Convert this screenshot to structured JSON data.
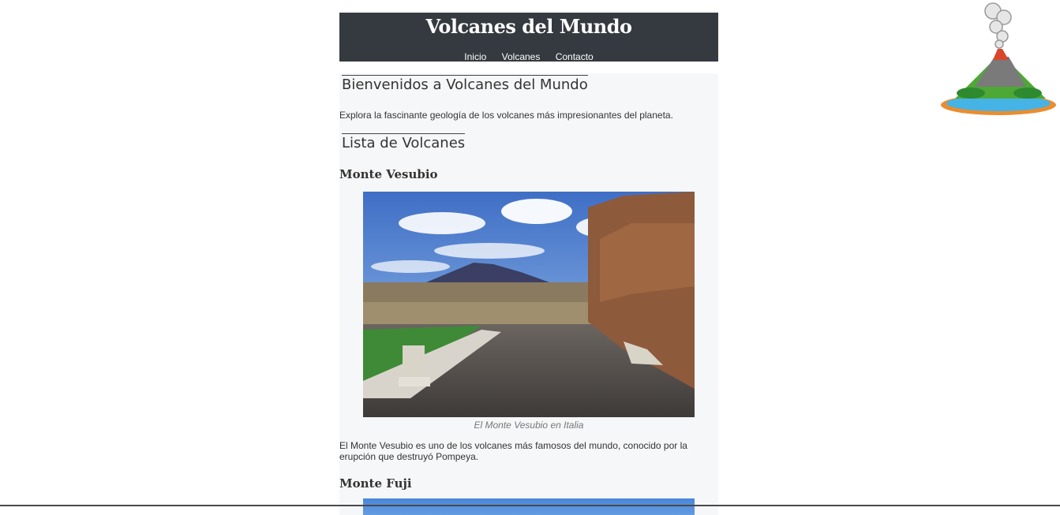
{
  "header": {
    "title": "Volcanes del Mundo",
    "nav": [
      "Inicio",
      "Volcanes",
      "Contacto"
    ]
  },
  "welcome": {
    "title": "Bienvenidos a Volcanes del Mundo",
    "text": "Explora la fascinante geología de los volcanes más impresionantes del planeta."
  },
  "list": {
    "title": "Lista de Volcanes",
    "volcanoes": [
      {
        "name": "Monte Vesubio",
        "caption": "El Monte Vesubio en Italia",
        "description": "El Monte Vesubio es uno de los volcanes más famosos del mundo, conocido por la erupción que destruyó Pompeya."
      },
      {
        "name": "Monte Fuji"
      }
    ]
  },
  "icons": {
    "logo": "volcano-logo-icon"
  },
  "colors": {
    "header_bg": "#343a40",
    "main_bg": "#f6f7f9"
  }
}
